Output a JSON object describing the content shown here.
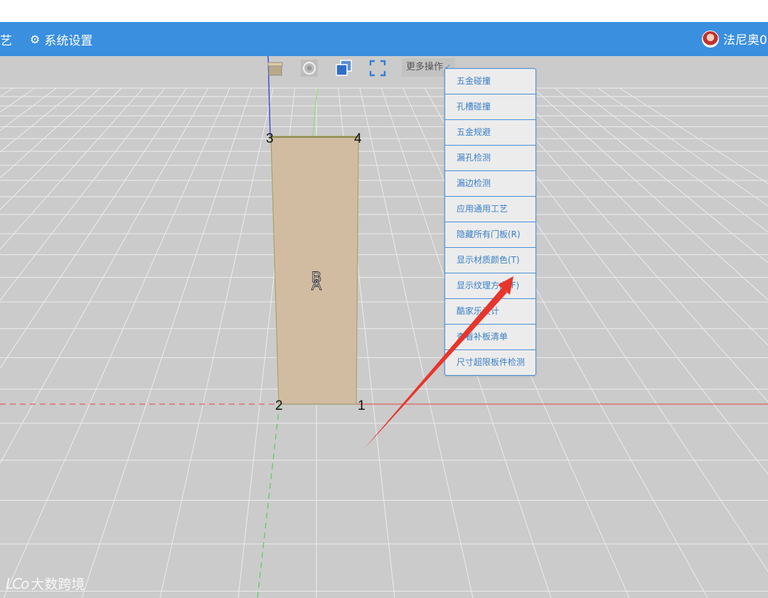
{
  "header": {
    "nav_craft": "艺",
    "nav_settings": "系统设置",
    "user_name": "法尼奥0"
  },
  "toolbar": {
    "more_label": "更多操作",
    "tools": [
      "box-icon",
      "target-icon",
      "layers-icon",
      "fullscreen-icon"
    ]
  },
  "dropdown": {
    "items": [
      "五金碰撞",
      "孔槽碰撞",
      "五金规避",
      "漏孔检测",
      "漏边检测",
      "应用通用工艺",
      "隐藏所有门板(R)",
      "显示材质颜色(T)",
      "显示纹理方向(F)",
      "酷家乐设计",
      "查看补板清单",
      "尺寸超限板件检测"
    ]
  },
  "panel": {
    "corner_labels": [
      "1",
      "2",
      "3",
      "4"
    ],
    "face_label_top": "B",
    "face_label_front": "A",
    "fill_color": "#d2bca1"
  },
  "watermark": {
    "logo": "LCo",
    "text": "大数跨境"
  }
}
